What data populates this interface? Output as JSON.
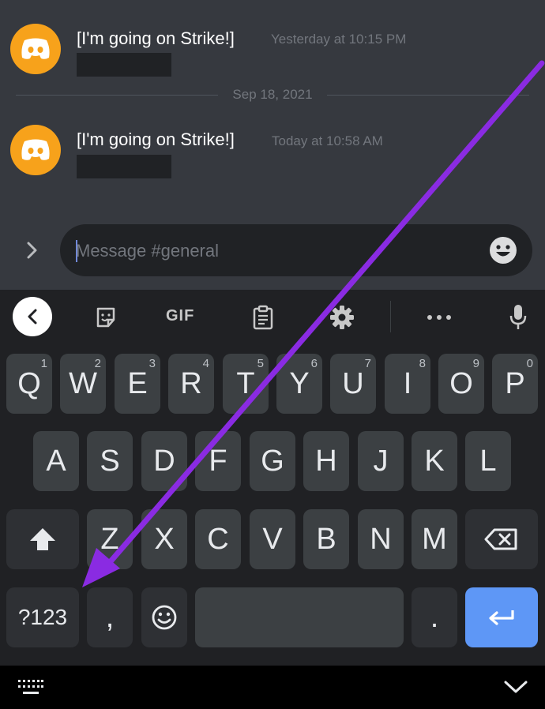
{
  "chat": {
    "messages": [
      {
        "username": "[I'm going on Strike!]",
        "timestamp": "Yesterday at 10:15 PM"
      },
      {
        "username": "[I'm going on Strike!]",
        "timestamp": "Today at 10:58 AM"
      }
    ],
    "date_divider": "Sep 18, 2021",
    "input_placeholder": "Message #general"
  },
  "keyboard": {
    "toolbar": {
      "gif_label": "GIF"
    },
    "row1": [
      {
        "label": "Q",
        "hint": "1"
      },
      {
        "label": "W",
        "hint": "2"
      },
      {
        "label": "E",
        "hint": "3"
      },
      {
        "label": "R",
        "hint": "4"
      },
      {
        "label": "T",
        "hint": "5"
      },
      {
        "label": "Y",
        "hint": "6"
      },
      {
        "label": "U",
        "hint": "7"
      },
      {
        "label": "I",
        "hint": "8"
      },
      {
        "label": "O",
        "hint": "9"
      },
      {
        "label": "P",
        "hint": "0"
      }
    ],
    "row2": [
      "A",
      "S",
      "D",
      "F",
      "G",
      "H",
      "J",
      "K",
      "L"
    ],
    "row3": [
      "Z",
      "X",
      "C",
      "V",
      "B",
      "N",
      "M"
    ],
    "symbols_label": "?123",
    "comma_label": ",",
    "period_label": "."
  },
  "colors": {
    "chat_background": "#36393f",
    "avatar": "#f7a21b",
    "keyboard_background": "#202124",
    "key": "#3c4043",
    "enter_key": "#5e97f6",
    "annotation_arrow": "#8a2be2"
  }
}
